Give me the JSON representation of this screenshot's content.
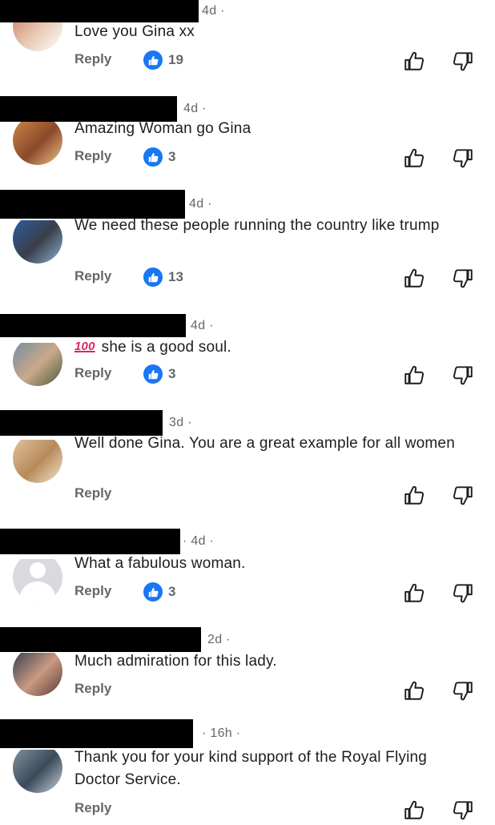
{
  "comments": [
    {
      "time": "4d ·",
      "text": "Love you Gina xx",
      "reply_label": "Reply",
      "likes": "19",
      "has_likes": true,
      "avatar": "photo",
      "colors": [
        "#c9745a",
        "#e8c9b4",
        "#ffffff"
      ]
    },
    {
      "time": "4d ·",
      "text": "Amazing Woman go Gina",
      "reply_label": "Reply",
      "likes": "3",
      "has_likes": true,
      "avatar": "photo",
      "colors": [
        "#d58a4a",
        "#8a4a2a",
        "#f1c08a"
      ]
    },
    {
      "time": "4d ·",
      "text": "We need these people running the country like trump",
      "reply_label": "Reply",
      "likes": "13",
      "has_likes": true,
      "avatar": "photo",
      "colors": [
        "#2c5fa8",
        "#3a3f4a",
        "#8fb3d9"
      ]
    },
    {
      "time": "4d ·",
      "text": "she is a good soul.",
      "emoji": "💯",
      "reply_label": "Reply",
      "likes": "3",
      "has_likes": true,
      "avatar": "photo",
      "colors": [
        "#6b8aa3",
        "#c9a98a",
        "#4a5a3a"
      ]
    },
    {
      "time": "3d ·",
      "text": "Well done Gina. You are a great example for all women",
      "reply_label": "Reply",
      "likes": "",
      "has_likes": false,
      "avatar": "photo",
      "colors": [
        "#e6c9a8",
        "#b88a5a",
        "#f3e3cf"
      ]
    },
    {
      "time": "· 4d ·",
      "text": "What a fabulous woman.",
      "reply_label": "Reply",
      "likes": "3",
      "has_likes": true,
      "avatar": "default",
      "colors": [
        "#d8dadf"
      ]
    },
    {
      "time": "2d ·",
      "text": "Much admiration for this lady.",
      "reply_label": "Reply",
      "likes": "",
      "has_likes": false,
      "avatar": "photo",
      "colors": [
        "#2a3550",
        "#c99a80",
        "#5a3a3a"
      ]
    },
    {
      "time": "· 16h ·",
      "text": "Thank you for your kind support of the Royal Flying Doctor Service.",
      "reply_label": "Reply",
      "likes": "",
      "has_likes": false,
      "avatar": "photo",
      "colors": [
        "#8a9aa8",
        "#3a4a5a",
        "#c8d2da"
      ]
    }
  ],
  "colors": {
    "like_blue": "#1877f2",
    "meta_gray": "#65676b",
    "text": "#1c1e21"
  },
  "icons": {
    "like_badge": "thumbs-up-icon",
    "upvote": "thumbs-up-outline-icon",
    "downvote": "thumbs-down-outline-icon"
  }
}
